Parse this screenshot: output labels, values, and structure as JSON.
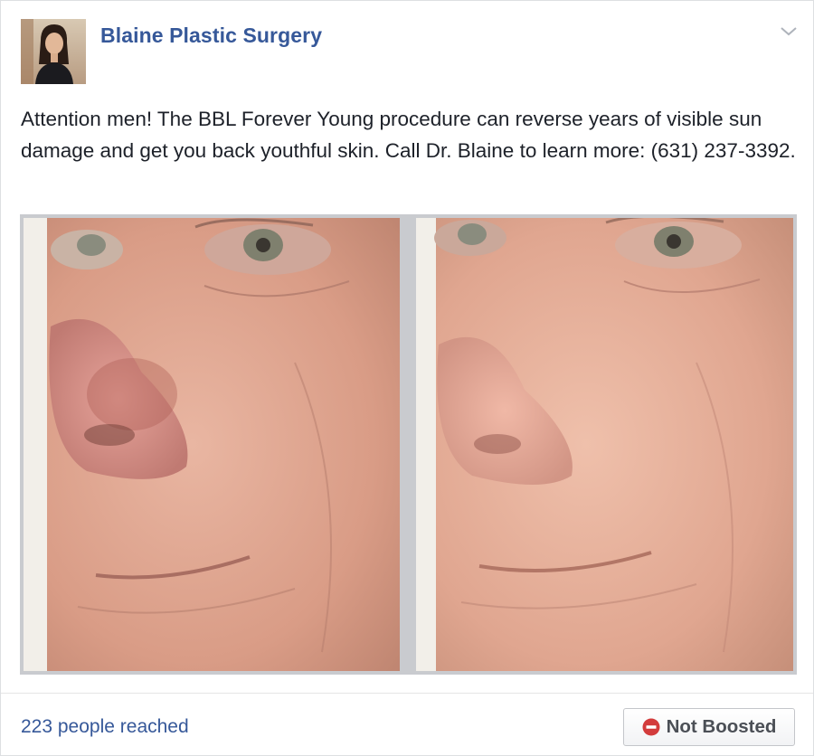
{
  "post": {
    "page_name": "Blaine Plastic Surgery",
    "text": "Attention men! The BBL Forever Young procedure can reverse years of visible sun damage and get you back youthful skin. Call Dr. Blaine to learn more: (631) 237-3392.",
    "options_icon": "chevron-down-icon",
    "avatar_icon": "profile-photo"
  },
  "photos": [
    {
      "name": "before-photo",
      "subject": "close-up face with sun damage"
    },
    {
      "name": "after-photo",
      "subject": "close-up face after treatment"
    }
  ],
  "footer": {
    "reach_text": "223 people reached",
    "boost_label": "Not Boosted",
    "boost_icon": "no-entry-icon"
  },
  "colors": {
    "link_blue": "#365899",
    "text": "#1d2129",
    "boost_icon_red": "#d33c3c"
  }
}
